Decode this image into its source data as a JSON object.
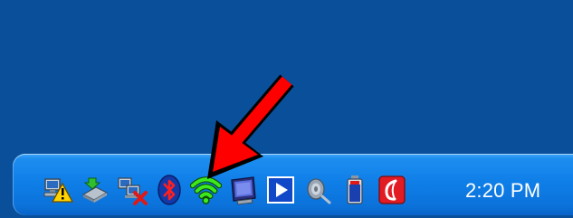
{
  "desktop": {
    "background": "#0a4f99"
  },
  "taskbar": {
    "background_accent": "#0f7fe8",
    "tray_icons": [
      {
        "name": "network-warning-icon"
      },
      {
        "name": "safely-remove-hardware-icon"
      },
      {
        "name": "network-disconnected-icon"
      },
      {
        "name": "bluetooth-icon"
      },
      {
        "name": "wireless-signal-icon"
      },
      {
        "name": "monitor-display-icon"
      },
      {
        "name": "media-play-icon"
      },
      {
        "name": "volume-speaker-icon"
      },
      {
        "name": "battery-icon"
      },
      {
        "name": "red-swirl-app-icon"
      }
    ],
    "clock": {
      "time": "2:20 PM"
    }
  },
  "annotation": {
    "arrow_color": "#ff0000",
    "target": "wireless-signal-icon"
  }
}
